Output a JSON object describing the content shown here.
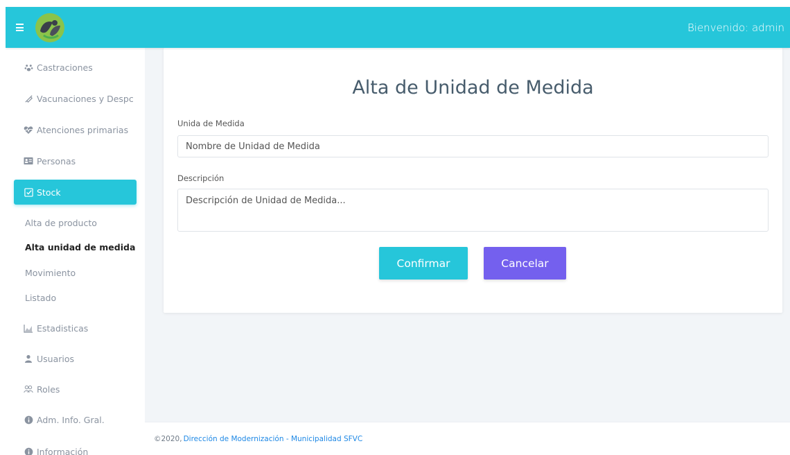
{
  "header": {
    "welcome_text": "Bienvenido: admin",
    "accent_color": "#26c6da"
  },
  "sidebar": {
    "items": [
      {
        "label": "Castraciones",
        "icon": "paw-icon"
      },
      {
        "label": "Vacunaciones y Despc",
        "icon": "syringe-icon"
      },
      {
        "label": "Atenciones primarias",
        "icon": "heartbeat-icon"
      },
      {
        "label": "Personas",
        "icon": "id-card-icon"
      },
      {
        "label": "Stock",
        "icon": "checkbox-icon"
      },
      {
        "label": "Estadisticas",
        "icon": "chart-icon"
      },
      {
        "label": "Usuarios",
        "icon": "user-icon"
      },
      {
        "label": "Roles",
        "icon": "users-icon"
      },
      {
        "label": "Adm. Info. Gral.",
        "icon": "info-icon"
      },
      {
        "label": "Información",
        "icon": "info-icon"
      }
    ],
    "stock_subitems": [
      {
        "label": "Alta de producto"
      },
      {
        "label": "Alta unidad de medida"
      },
      {
        "label": "Movimiento"
      },
      {
        "label": "Listado"
      }
    ]
  },
  "form": {
    "title": "Alta de Unidad de Medida",
    "unit_label": "Unida de Medida",
    "unit_placeholder": "Nombre de Unidad de Medida",
    "description_label": "Descripción",
    "description_placeholder": "Descripción de Unidad de Medida...",
    "confirm_label": "Confirmar",
    "cancel_label": "Cancelar",
    "confirm_color": "#26c6da",
    "cancel_color": "#7460ee"
  },
  "footer": {
    "copyright": "©2020,",
    "link_text": "Dirección de Modernización - Municipalidad SFVC"
  }
}
